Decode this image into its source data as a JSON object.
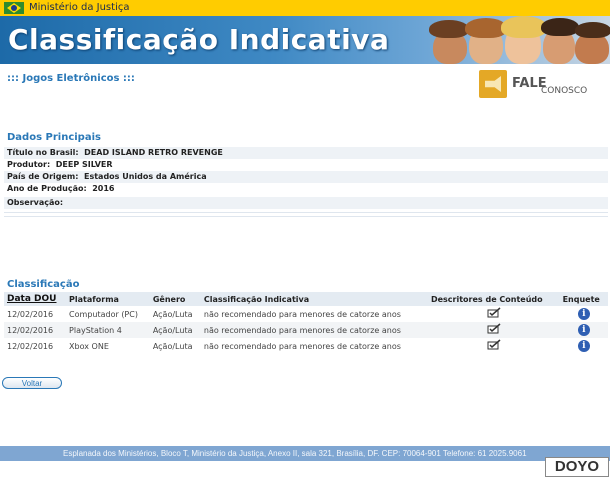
{
  "header": {
    "ministry": "Ministério da Justiça",
    "banner_title": "Classificação Indicativa"
  },
  "section": {
    "title": "::: Jogos Eletrônicos :::"
  },
  "contact": {
    "main": "FALE",
    "sub": "CONOSCO"
  },
  "dados": {
    "title": "Dados Principais",
    "fields": [
      {
        "label": "Título no Brasil:",
        "value": "DEAD ISLAND RETRO REVENGE"
      },
      {
        "label": "Produtor:",
        "value": "DEEP SILVER"
      },
      {
        "label": "País de Origem:",
        "value": "Estados Unidos da América"
      },
      {
        "label": "Ano de Produção:",
        "value": "2016"
      },
      {
        "label": "Observação:",
        "value": ""
      }
    ]
  },
  "classificacao": {
    "title": "Classificação",
    "headers": [
      "Data DOU",
      "Plataforma",
      "Gênero",
      "Classificação Indicativa",
      "Descritores de Conteúdo",
      "Enquete"
    ],
    "rows": [
      {
        "date": "12/02/2016",
        "platform": "Computador (PC)",
        "genre": "Ação/Luta",
        "rating": "não recomendado para menores de catorze anos"
      },
      {
        "date": "12/02/2016",
        "platform": "PlayStation 4",
        "genre": "Ação/Luta",
        "rating": "não recomendado para menores de catorze anos"
      },
      {
        "date": "12/02/2016",
        "platform": "Xbox ONE",
        "genre": "Ação/Luta",
        "rating": "não recomendado para menores de catorze anos"
      }
    ]
  },
  "actions": {
    "back": "Voltar"
  },
  "footer": {
    "text": "Esplanada dos Ministérios, Bloco T, Ministério da Justiça, Anexo II, sala 321, Brasília, DF. CEP: 70064-901 Telefone: 61 2025.9061"
  },
  "watermark": "DOYO",
  "icons": {
    "flag": "brazil-flag-icon",
    "contact": "megaphone-icon",
    "descriptor": "checklist-icon",
    "poll": "info-icon"
  },
  "colors": {
    "topbar": "#ffcc00",
    "banner": "#1d6aa8",
    "heading": "#2a78b7",
    "rating": "#8a2a8a",
    "footer": "#7fa6d2"
  }
}
